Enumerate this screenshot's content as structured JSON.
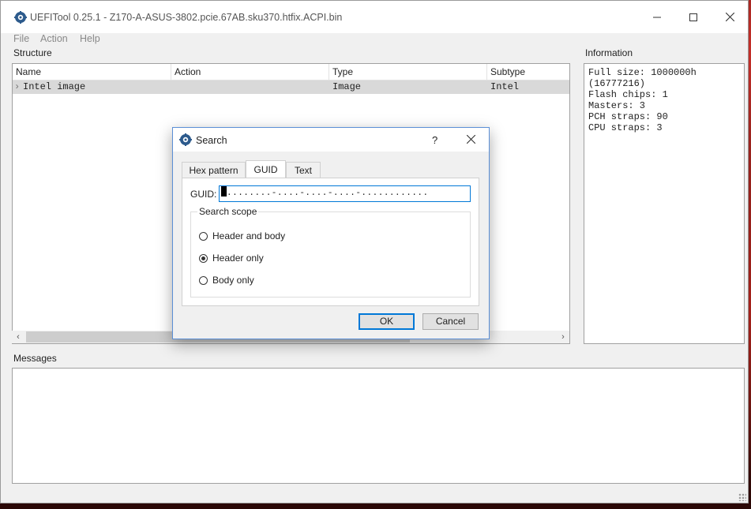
{
  "window": {
    "title": "UEFITool 0.25.1 - Z170-A-ASUS-3802.pcie.67AB.sku370.htfix.ACPI.bin"
  },
  "menu": [
    "File",
    "Action",
    "Help"
  ],
  "structure": {
    "label": "Structure",
    "columns": [
      "Name",
      "Action",
      "Type",
      "Subtype"
    ],
    "rows": [
      {
        "name": "Intel image",
        "action": "",
        "type": "Image",
        "subtype": "Intel"
      }
    ]
  },
  "information": {
    "label": "Information",
    "lines": [
      "Full size: 1000000h",
      "(16777216)",
      "Flash chips: 1",
      "Masters: 3",
      "PCH straps: 90",
      "CPU straps: 3"
    ]
  },
  "messages": {
    "label": "Messages"
  },
  "dialog": {
    "title": "Search",
    "help": "?",
    "tabs": [
      "Hex pattern",
      "GUID",
      "Text"
    ],
    "active_tab": "GUID",
    "guid_label": "GUID:",
    "guid_value": "........-....-....-....-............",
    "scope_label": "Search scope",
    "options": [
      "Header and body",
      "Header only",
      "Body only"
    ],
    "selected_option": "Header only",
    "ok_label": "OK",
    "cancel_label": "Cancel"
  },
  "colors": {
    "accent": "#0078d7",
    "selection": "#d9d9d9"
  },
  "icons": [
    "uefitool-icon",
    "minimize-icon",
    "maximize-icon",
    "close-icon",
    "help-icon"
  ]
}
